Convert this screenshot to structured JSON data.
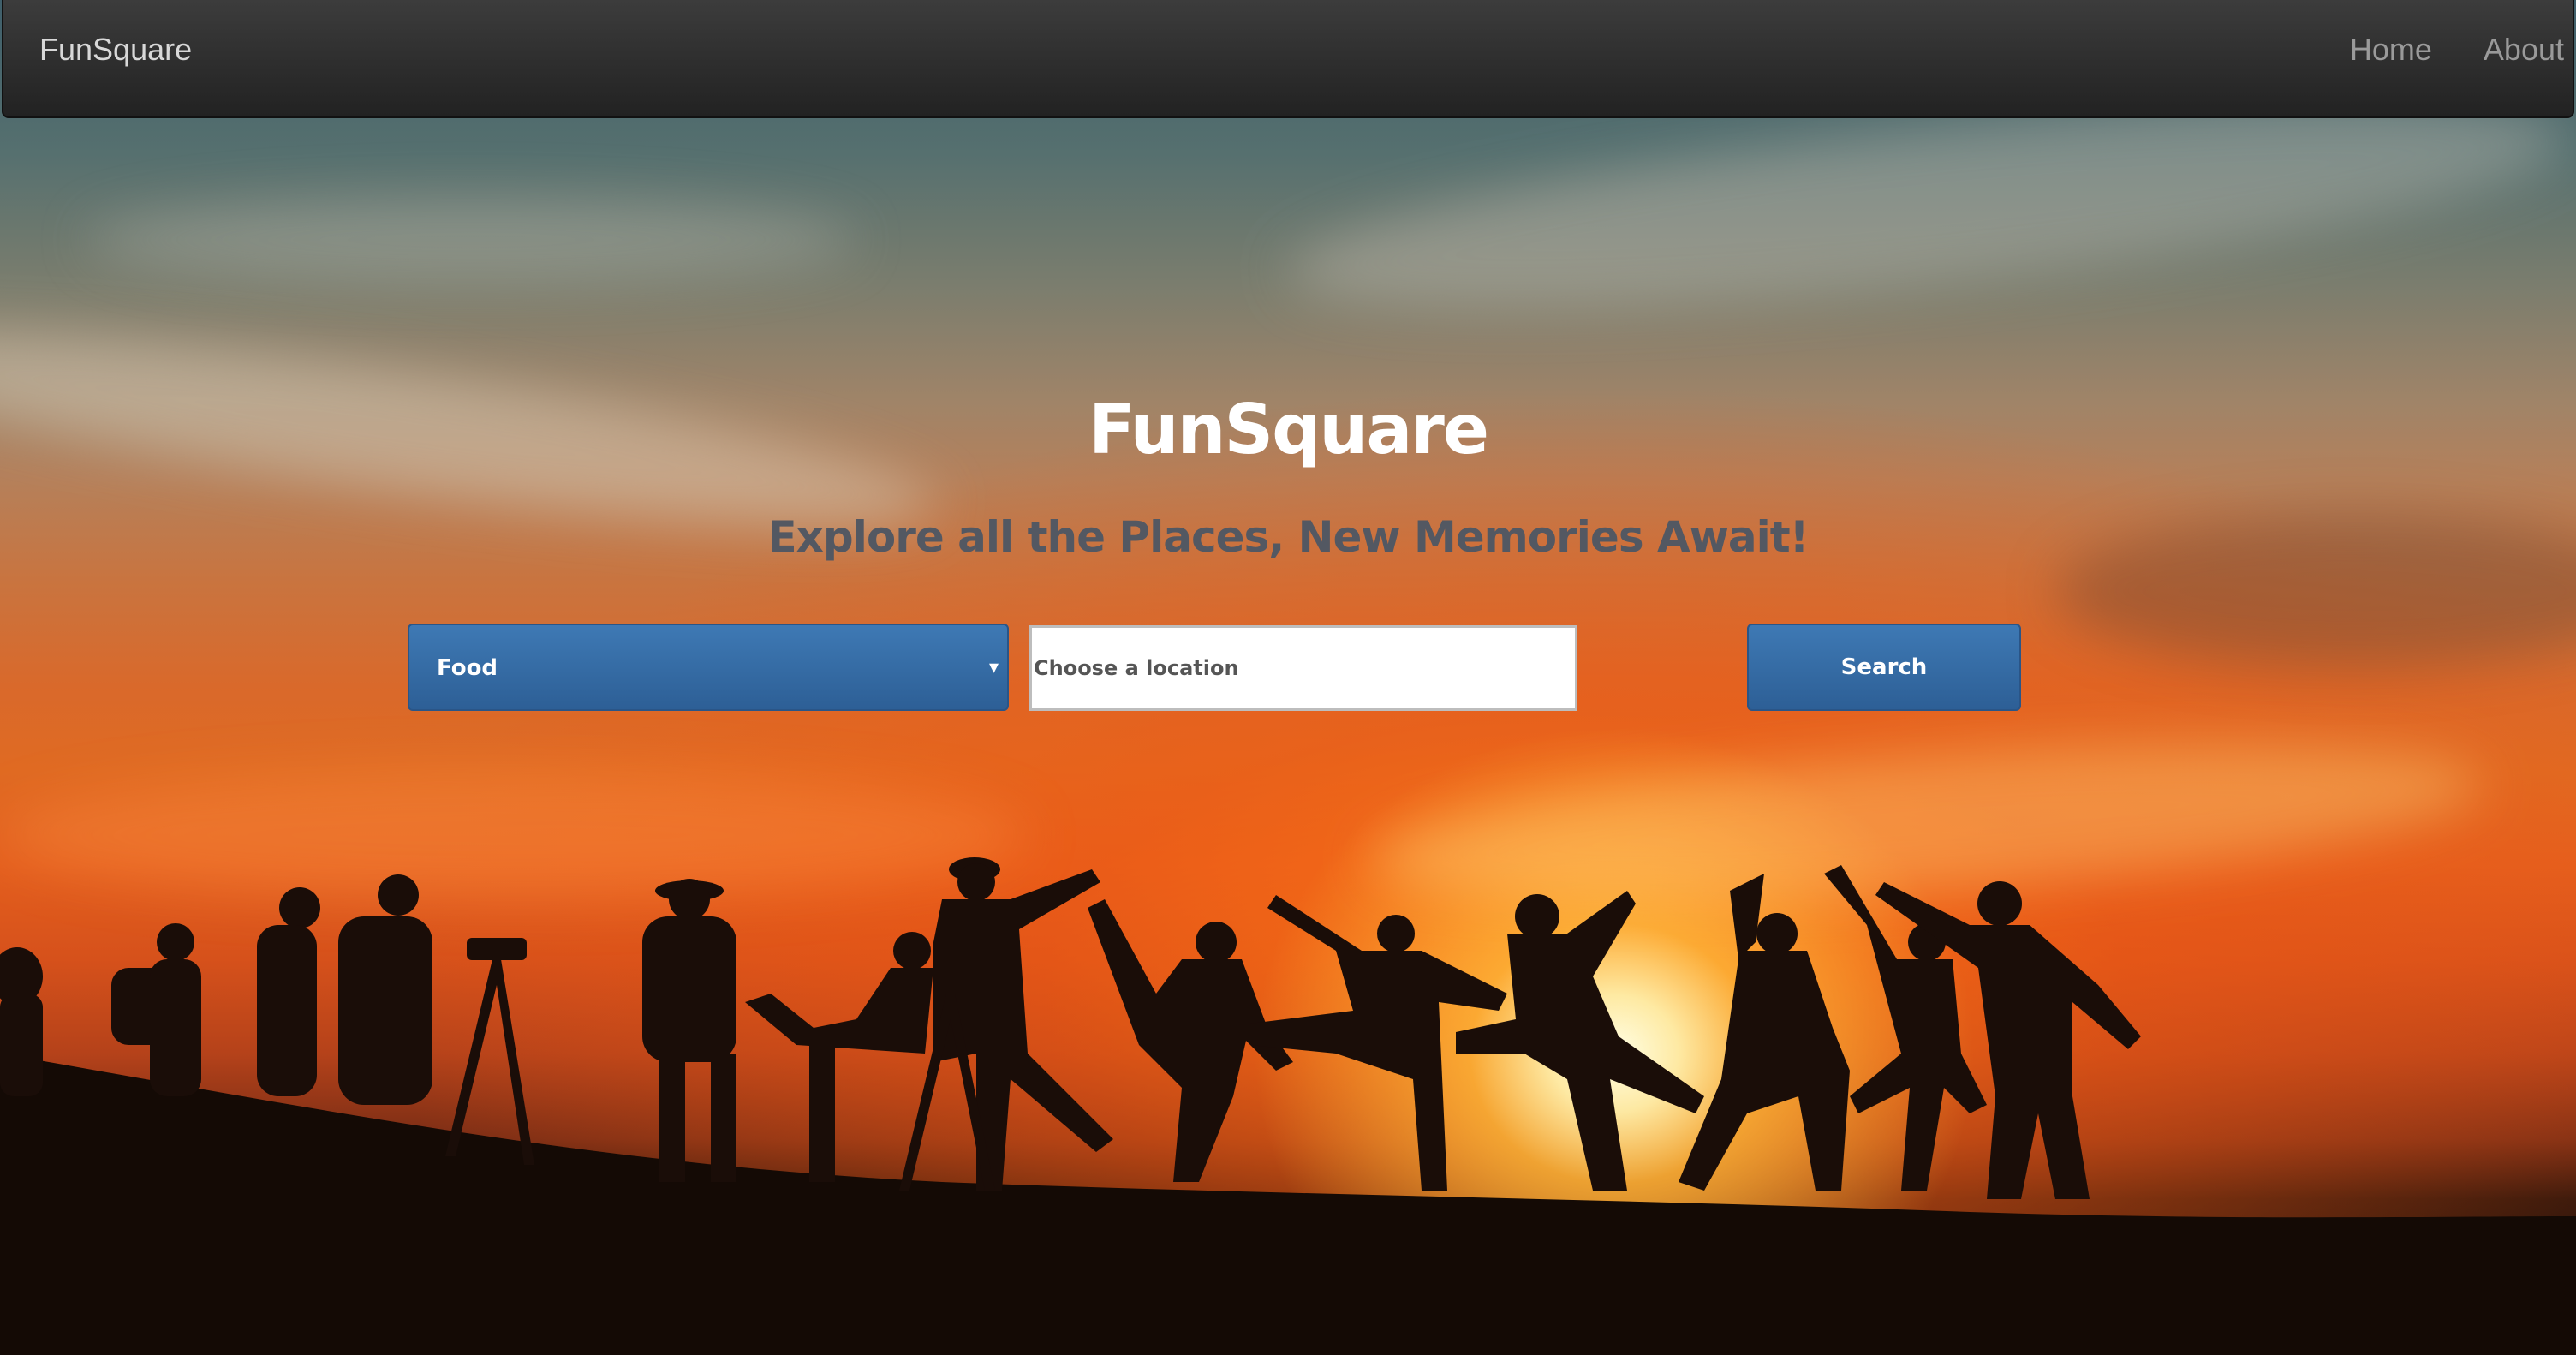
{
  "navbar": {
    "brand": "FunSquare",
    "links": [
      {
        "label": "Home"
      },
      {
        "label": "About"
      }
    ]
  },
  "hero": {
    "title": "FunSquare",
    "subtitle": "Explore all the Places, New Memories Await!",
    "category_select": {
      "selected": "Food",
      "caret_icon": "caret-down-icon",
      "caret_glyph": "▾"
    },
    "location_input": {
      "value": "",
      "placeholder": "Choose a location"
    },
    "search_button": {
      "label": "Search"
    }
  },
  "colors": {
    "navbar_bg": "#2b2b2b",
    "button_blue": "#336ba6",
    "subtitle_gray": "#535862"
  }
}
